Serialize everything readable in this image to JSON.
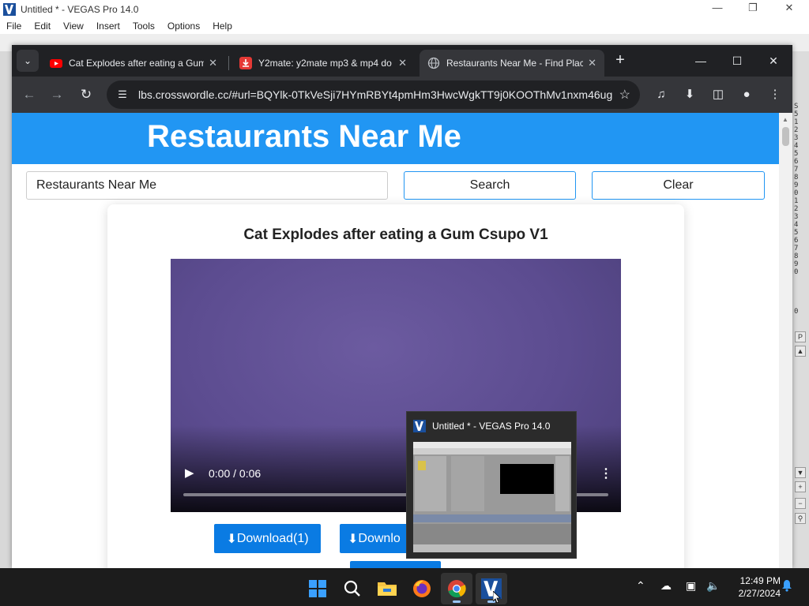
{
  "vegas": {
    "title": "Untitled * - VEGAS Pro 14.0",
    "menu": [
      "File",
      "Edit",
      "View",
      "Insert",
      "Tools",
      "Options",
      "Help"
    ],
    "ruler_text": "S\n5\n1\n2\n3\n4\n5\n6\n7\n8\n9\n0\n1\n2\n3\n4\n5\n6\n7\n8\n9\n0\n\n\n\n\n0"
  },
  "browser": {
    "tabs": [
      {
        "title": "Cat Explodes after eating a Gum",
        "favicon": "youtube-icon",
        "color": "#ff0000",
        "active": false
      },
      {
        "title": "Y2mate: y2mate mp3 & mp4 do",
        "favicon": "download-icon",
        "color": "#e53935",
        "active": false
      },
      {
        "title": "Restaurants Near Me - Find Plac",
        "favicon": "globe-icon",
        "color": "#9aa0a6",
        "active": true
      }
    ],
    "url": "lbs.crosswordle.cc/#url=BQYlk-0TkVeSji7HYmRBYt4pmHm3HwcWgkTT9j0KOOThMv1nxm46ugA..."
  },
  "page": {
    "header_title": "Restaurants Near Me",
    "search_value": "Restaurants Near Me",
    "search_button": "Search",
    "clear_button": "Clear",
    "video_title": "Cat Explodes after eating a Gum Csupo V1",
    "video_time": "0:00 / 0:06",
    "download1": "Download(1)",
    "download2": "Downlo"
  },
  "thumbnail": {
    "title": "Untitled * - VEGAS Pro 14.0"
  },
  "taskbar": {
    "apps": [
      "windows-start-icon",
      "search-icon",
      "file-explorer-icon",
      "firefox-icon",
      "chrome-icon",
      "vegas-icon"
    ],
    "time": "12:49 PM",
    "date": "2/27/2024"
  },
  "colors": {
    "header_blue": "#2196f3",
    "button_blue": "#0a7be3",
    "chrome_dark": "#202124"
  }
}
